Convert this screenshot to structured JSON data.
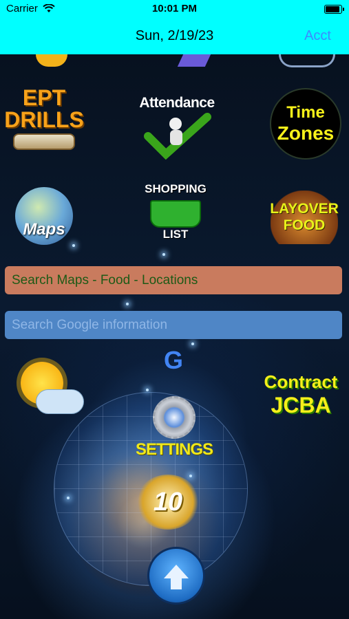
{
  "status_bar": {
    "carrier": "Carrier",
    "time": "10:01 PM"
  },
  "nav": {
    "title": "Sun, 2/19/23",
    "acct_label": "Acct"
  },
  "tiles": {
    "ept_line1": "EPT",
    "ept_line2": "DRILLS",
    "attendance": "Attendance",
    "time_line1": "Time",
    "time_line2": "Zones",
    "maps": "Maps",
    "shopping_line1": "SHOPPING",
    "shopping_line2": "LIST",
    "layover_line1": "LAYOVER",
    "layover_line2": "FOOD",
    "contract_line1": "Contract",
    "contract_line2": "JCBA",
    "settings": "SETTINGS",
    "anniversary_number": "10",
    "google_letter": "G"
  },
  "search": {
    "maps_value": "Search Maps - Food - Locations",
    "google_placeholder": "Search Google information"
  },
  "icons": [
    "wifi-icon",
    "battery-icon",
    "ept-drills-icon",
    "attendance-icon",
    "time-zones-icon",
    "maps-icon",
    "shopping-list-icon",
    "layover-food-icon",
    "google-icon",
    "weather-icon",
    "contract-jcba-icon",
    "settings-icon",
    "anniversary-icon",
    "up-arrow-icon"
  ],
  "colors": {
    "header": "#00ffff",
    "acct": "#3b8bff",
    "maps_search_bg": "#c97b5e",
    "maps_search_text": "#1d5a16",
    "google_search_bg": "#4f86c6"
  }
}
